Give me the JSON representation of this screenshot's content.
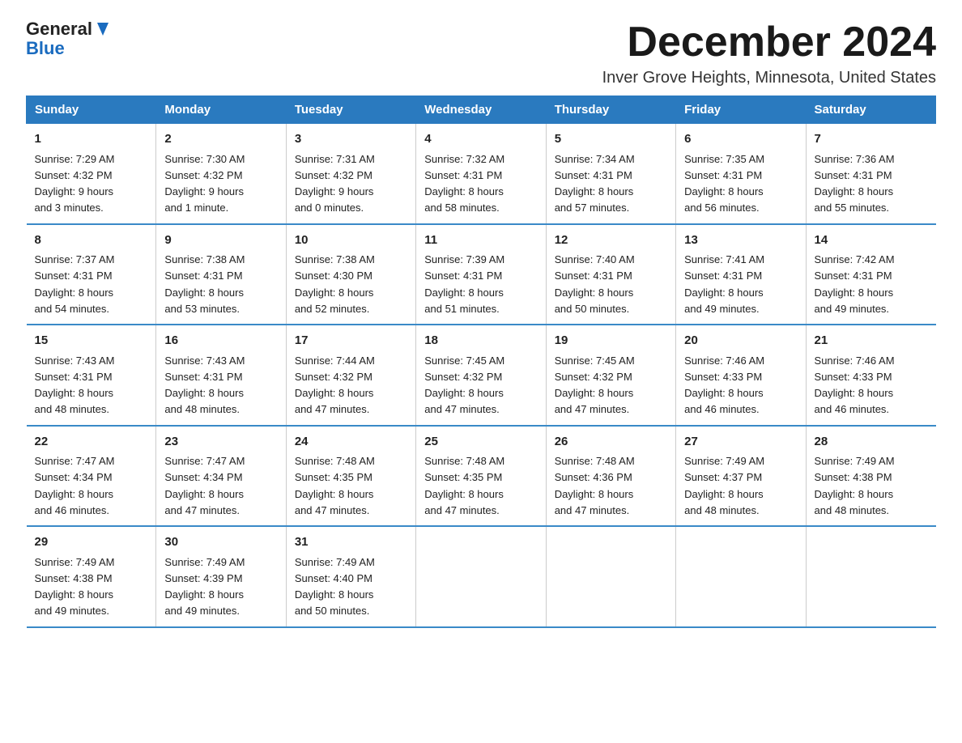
{
  "header": {
    "logo_general": "General",
    "logo_blue": "Blue",
    "month_title": "December 2024",
    "location": "Inver Grove Heights, Minnesota, United States"
  },
  "weekdays": [
    "Sunday",
    "Monday",
    "Tuesday",
    "Wednesday",
    "Thursday",
    "Friday",
    "Saturday"
  ],
  "weeks": [
    [
      {
        "day": "1",
        "sunrise": "7:29 AM",
        "sunset": "4:32 PM",
        "daylight": "9 hours and 3 minutes."
      },
      {
        "day": "2",
        "sunrise": "7:30 AM",
        "sunset": "4:32 PM",
        "daylight": "9 hours and 1 minute."
      },
      {
        "day": "3",
        "sunrise": "7:31 AM",
        "sunset": "4:32 PM",
        "daylight": "9 hours and 0 minutes."
      },
      {
        "day": "4",
        "sunrise": "7:32 AM",
        "sunset": "4:31 PM",
        "daylight": "8 hours and 58 minutes."
      },
      {
        "day": "5",
        "sunrise": "7:34 AM",
        "sunset": "4:31 PM",
        "daylight": "8 hours and 57 minutes."
      },
      {
        "day": "6",
        "sunrise": "7:35 AM",
        "sunset": "4:31 PM",
        "daylight": "8 hours and 56 minutes."
      },
      {
        "day": "7",
        "sunrise": "7:36 AM",
        "sunset": "4:31 PM",
        "daylight": "8 hours and 55 minutes."
      }
    ],
    [
      {
        "day": "8",
        "sunrise": "7:37 AM",
        "sunset": "4:31 PM",
        "daylight": "8 hours and 54 minutes."
      },
      {
        "day": "9",
        "sunrise": "7:38 AM",
        "sunset": "4:31 PM",
        "daylight": "8 hours and 53 minutes."
      },
      {
        "day": "10",
        "sunrise": "7:38 AM",
        "sunset": "4:30 PM",
        "daylight": "8 hours and 52 minutes."
      },
      {
        "day": "11",
        "sunrise": "7:39 AM",
        "sunset": "4:31 PM",
        "daylight": "8 hours and 51 minutes."
      },
      {
        "day": "12",
        "sunrise": "7:40 AM",
        "sunset": "4:31 PM",
        "daylight": "8 hours and 50 minutes."
      },
      {
        "day": "13",
        "sunrise": "7:41 AM",
        "sunset": "4:31 PM",
        "daylight": "8 hours and 49 minutes."
      },
      {
        "day": "14",
        "sunrise": "7:42 AM",
        "sunset": "4:31 PM",
        "daylight": "8 hours and 49 minutes."
      }
    ],
    [
      {
        "day": "15",
        "sunrise": "7:43 AM",
        "sunset": "4:31 PM",
        "daylight": "8 hours and 48 minutes."
      },
      {
        "day": "16",
        "sunrise": "7:43 AM",
        "sunset": "4:31 PM",
        "daylight": "8 hours and 48 minutes."
      },
      {
        "day": "17",
        "sunrise": "7:44 AM",
        "sunset": "4:32 PM",
        "daylight": "8 hours and 47 minutes."
      },
      {
        "day": "18",
        "sunrise": "7:45 AM",
        "sunset": "4:32 PM",
        "daylight": "8 hours and 47 minutes."
      },
      {
        "day": "19",
        "sunrise": "7:45 AM",
        "sunset": "4:32 PM",
        "daylight": "8 hours and 47 minutes."
      },
      {
        "day": "20",
        "sunrise": "7:46 AM",
        "sunset": "4:33 PM",
        "daylight": "8 hours and 46 minutes."
      },
      {
        "day": "21",
        "sunrise": "7:46 AM",
        "sunset": "4:33 PM",
        "daylight": "8 hours and 46 minutes."
      }
    ],
    [
      {
        "day": "22",
        "sunrise": "7:47 AM",
        "sunset": "4:34 PM",
        "daylight": "8 hours and 46 minutes."
      },
      {
        "day": "23",
        "sunrise": "7:47 AM",
        "sunset": "4:34 PM",
        "daylight": "8 hours and 47 minutes."
      },
      {
        "day": "24",
        "sunrise": "7:48 AM",
        "sunset": "4:35 PM",
        "daylight": "8 hours and 47 minutes."
      },
      {
        "day": "25",
        "sunrise": "7:48 AM",
        "sunset": "4:35 PM",
        "daylight": "8 hours and 47 minutes."
      },
      {
        "day": "26",
        "sunrise": "7:48 AM",
        "sunset": "4:36 PM",
        "daylight": "8 hours and 47 minutes."
      },
      {
        "day": "27",
        "sunrise": "7:49 AM",
        "sunset": "4:37 PM",
        "daylight": "8 hours and 48 minutes."
      },
      {
        "day": "28",
        "sunrise": "7:49 AM",
        "sunset": "4:38 PM",
        "daylight": "8 hours and 48 minutes."
      }
    ],
    [
      {
        "day": "29",
        "sunrise": "7:49 AM",
        "sunset": "4:38 PM",
        "daylight": "8 hours and 49 minutes."
      },
      {
        "day": "30",
        "sunrise": "7:49 AM",
        "sunset": "4:39 PM",
        "daylight": "8 hours and 49 minutes."
      },
      {
        "day": "31",
        "sunrise": "7:49 AM",
        "sunset": "4:40 PM",
        "daylight": "8 hours and 50 minutes."
      },
      null,
      null,
      null,
      null
    ]
  ],
  "labels": {
    "sunrise": "Sunrise:",
    "sunset": "Sunset:",
    "daylight": "Daylight:"
  }
}
